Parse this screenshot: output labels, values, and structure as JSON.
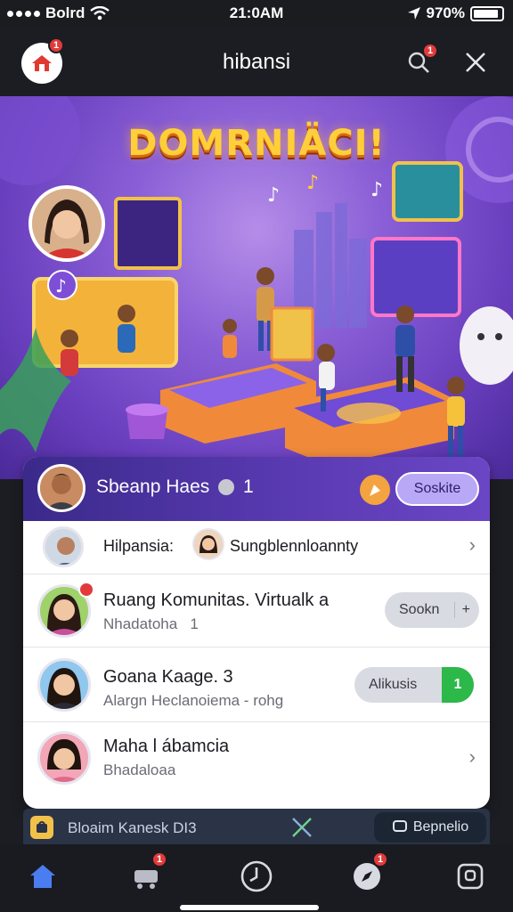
{
  "status_bar": {
    "carrier": "Bolrd",
    "time": "21:0AM",
    "battery_text": "970%",
    "battery_level": 0.9
  },
  "header": {
    "title": "hibansi",
    "logo_badge": "1",
    "search_badge": "1",
    "logo_icon": "house-icon",
    "search_icon": "search-icon",
    "close_icon": "close-icon"
  },
  "hero": {
    "title": "DOMRNIÄCI!"
  },
  "card": {
    "header": {
      "name": "Sbeanp Haes",
      "count": "1",
      "button": "Soskite"
    },
    "rows": [
      {
        "left_label": "Hilpansia:",
        "right_label": "Sungblennloannty"
      },
      {
        "title": "Ruang Komunitas. Virtualk a",
        "subtitle": "Nhadatoha",
        "subtitle_count": "1",
        "button": "Sookn",
        "button_extra": "+"
      },
      {
        "title": "Goana Kaage. 3",
        "subtitle": "Alargn Heclanoiema - rohg",
        "button": "Alikusis",
        "button_extra": "1"
      },
      {
        "title": "Maha l ábamcia",
        "subtitle": "Bhadaloaa"
      }
    ]
  },
  "strip": {
    "label": "Bloaim Kanesk DI3",
    "button": "Bepnelio"
  },
  "tabbar": {
    "cart_badge": "1",
    "compass_badge": "1"
  },
  "colors": {
    "accent_purple": "#6a46c4",
    "badge_red": "#e23a3a",
    "green_button": "#2db84a"
  }
}
